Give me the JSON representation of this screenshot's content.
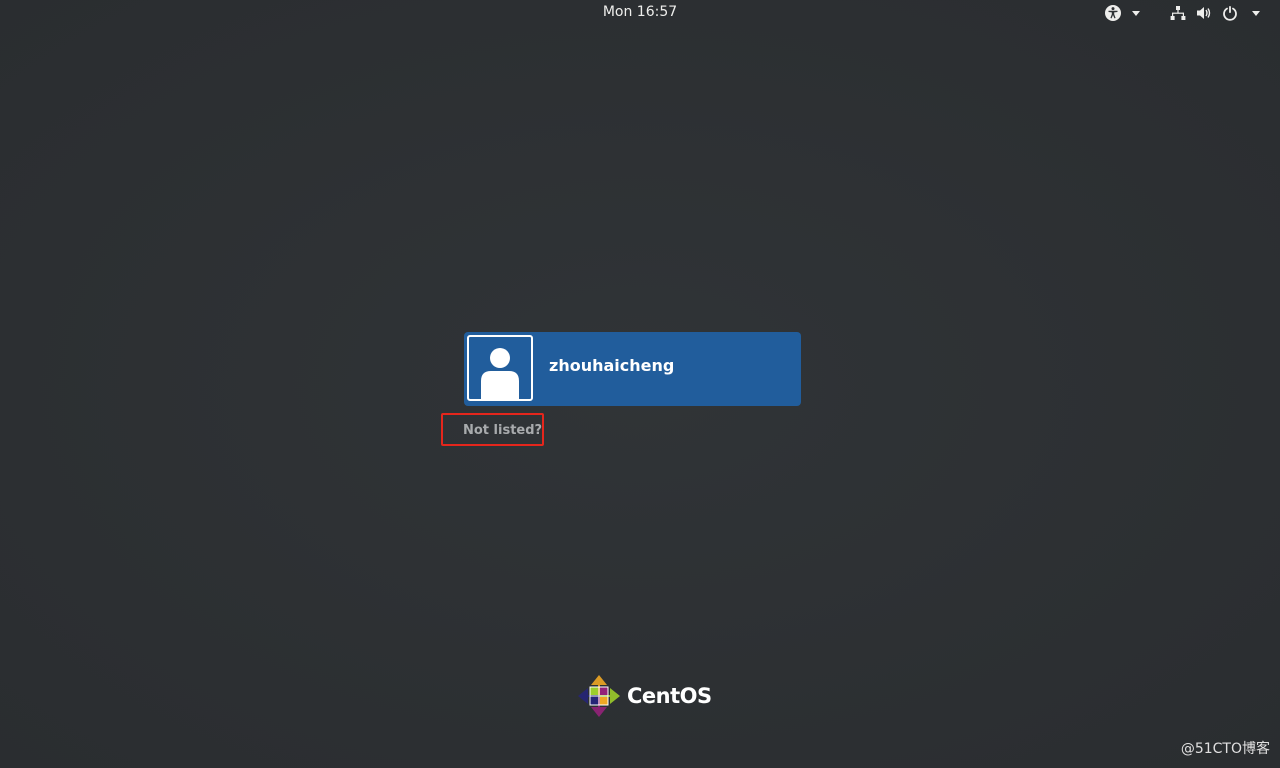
{
  "topbar": {
    "clock": "Mon 16:57",
    "icons": {
      "accessibility": "accessibility-icon",
      "network": "network-wired-icon",
      "volume": "speaker-volume-icon",
      "power": "power-icon",
      "dropdown": "chevron-down-icon"
    }
  },
  "login": {
    "users": [
      {
        "name": "zhouhaicheng",
        "avatar_icon": "user-avatar-icon"
      }
    ],
    "not_listed_label": "Not listed?"
  },
  "branding": {
    "logo_text": "CentOS",
    "logo_icon": "centos-logo-icon"
  },
  "watermark": "@51CTO博客",
  "colors": {
    "background": "#2e3134",
    "user_selected": "#215d9c",
    "highlight_box": "#e5261c"
  }
}
